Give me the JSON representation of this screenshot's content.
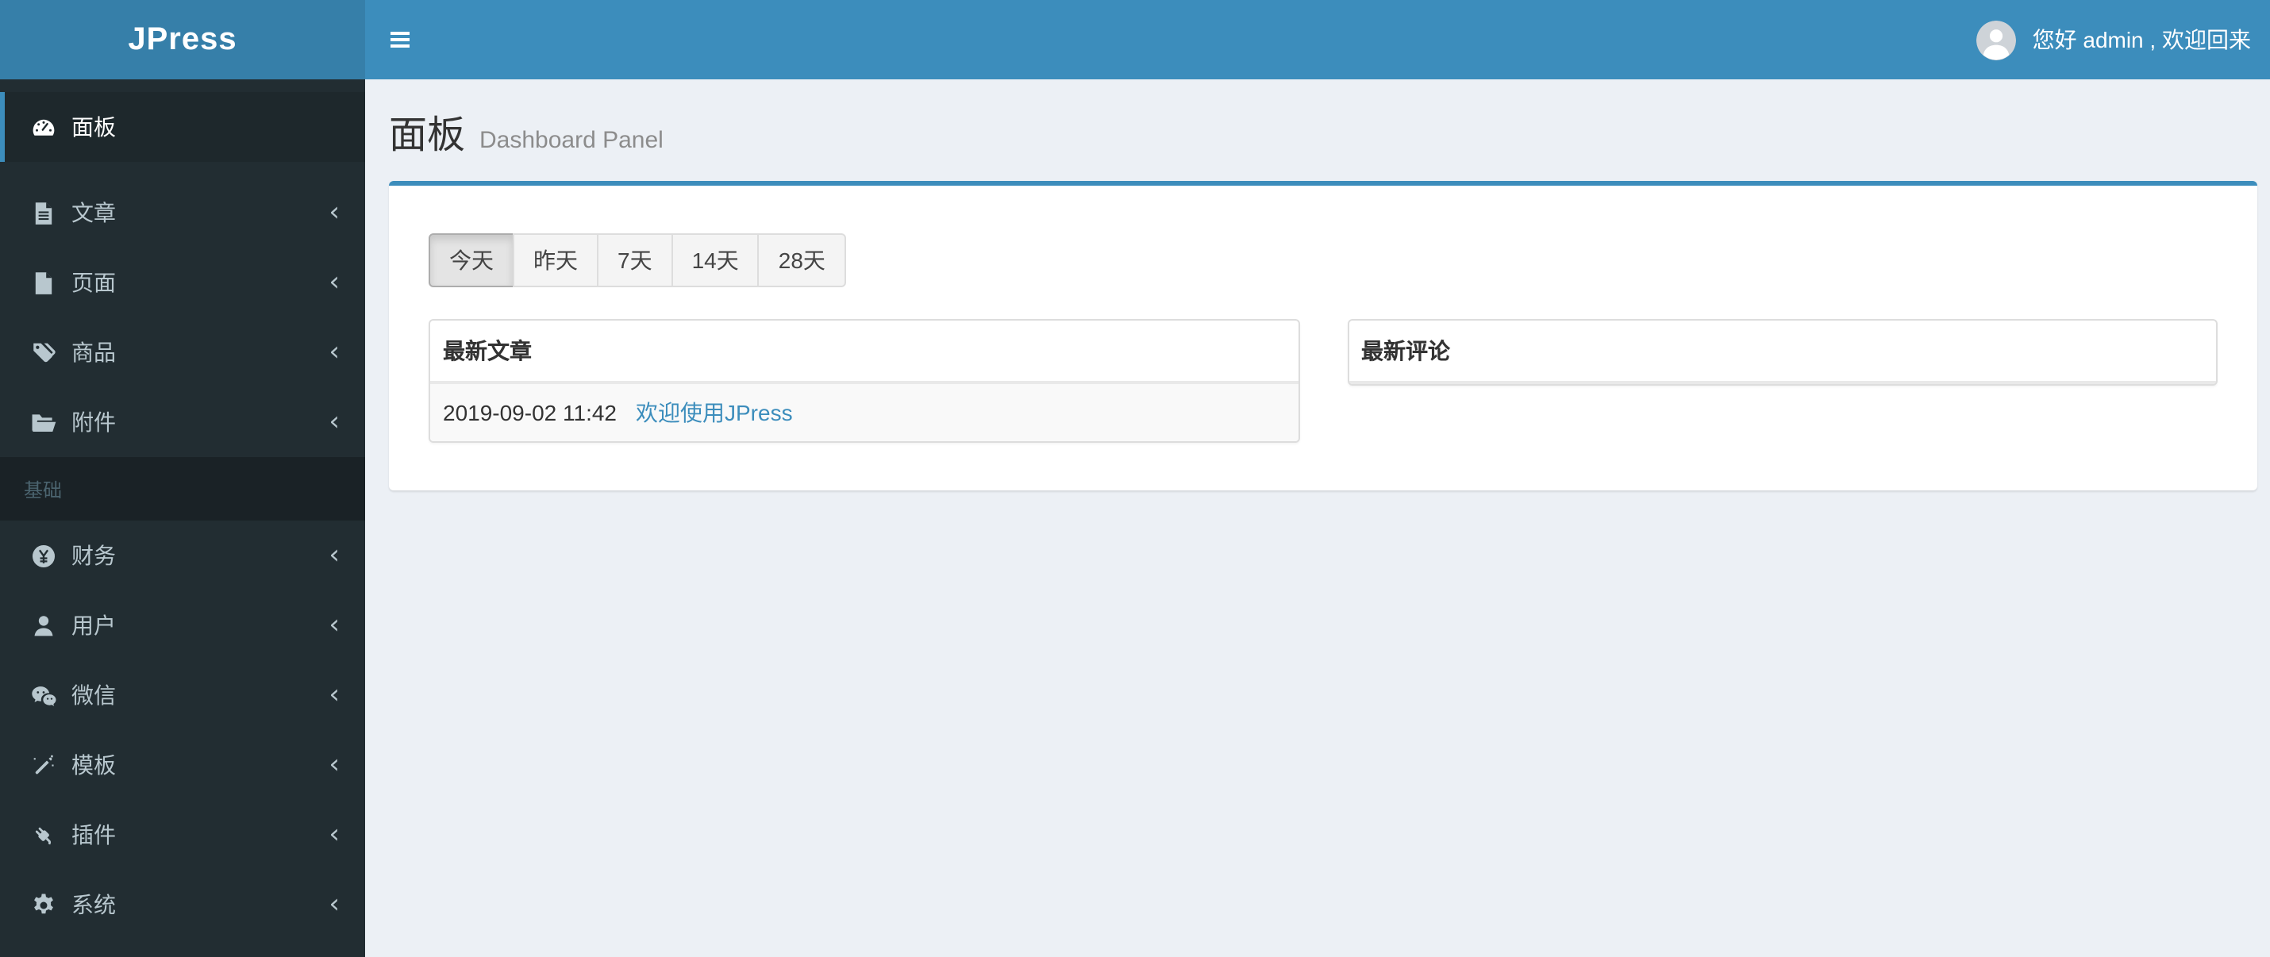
{
  "header": {
    "logo_text": "JPress",
    "greeting": "您好 admin , 欢迎回来"
  },
  "sidebar": {
    "items": [
      {
        "label": "面板",
        "icon": "tachometer",
        "active": true,
        "has_children": false
      },
      {
        "label": "文章",
        "icon": "file-text",
        "active": false,
        "has_children": true
      },
      {
        "label": "页面",
        "icon": "file",
        "active": false,
        "has_children": true
      },
      {
        "label": "商品",
        "icon": "tags",
        "active": false,
        "has_children": true
      },
      {
        "label": "附件",
        "icon": "folder-open",
        "active": false,
        "has_children": true
      },
      {
        "label": "基础",
        "type": "section-header"
      },
      {
        "label": "财务",
        "icon": "yen-circle",
        "active": false,
        "has_children": true
      },
      {
        "label": "用户",
        "icon": "user",
        "active": false,
        "has_children": true
      },
      {
        "label": "微信",
        "icon": "wechat",
        "active": false,
        "has_children": true
      },
      {
        "label": "模板",
        "icon": "magic-wand",
        "active": false,
        "has_children": true
      },
      {
        "label": "插件",
        "icon": "plug",
        "active": false,
        "has_children": true
      },
      {
        "label": "系统",
        "icon": "gear",
        "active": false,
        "has_children": true
      }
    ]
  },
  "content": {
    "title": "面板",
    "subtitle": "Dashboard Panel",
    "filters": [
      {
        "label": "今天",
        "active": true
      },
      {
        "label": "昨天",
        "active": false
      },
      {
        "label": "7天",
        "active": false
      },
      {
        "label": "14天",
        "active": false
      },
      {
        "label": "28天",
        "active": false
      }
    ],
    "latest_articles": {
      "title": "最新文章",
      "rows": [
        {
          "time": "2019-09-02 11:42",
          "link_text": "欢迎使用JPress"
        }
      ]
    },
    "latest_comments": {
      "title": "最新评论",
      "rows": []
    }
  },
  "colors": {
    "accent": "#3c8dbc",
    "logo_bg": "#367fa9",
    "sidebar_bg": "#222d32",
    "sidebar_active_bg": "#1e282c",
    "sidebar_section_bg": "#1a2226",
    "sidebar_text": "#b8c7ce",
    "sidebar_section_text": "#4b646f",
    "content_bg": "#ecf0f5",
    "link": "#3c8dbc",
    "stripe_row_bg": "#f9f9f9",
    "btn_default_bg": "#f4f4f4"
  }
}
